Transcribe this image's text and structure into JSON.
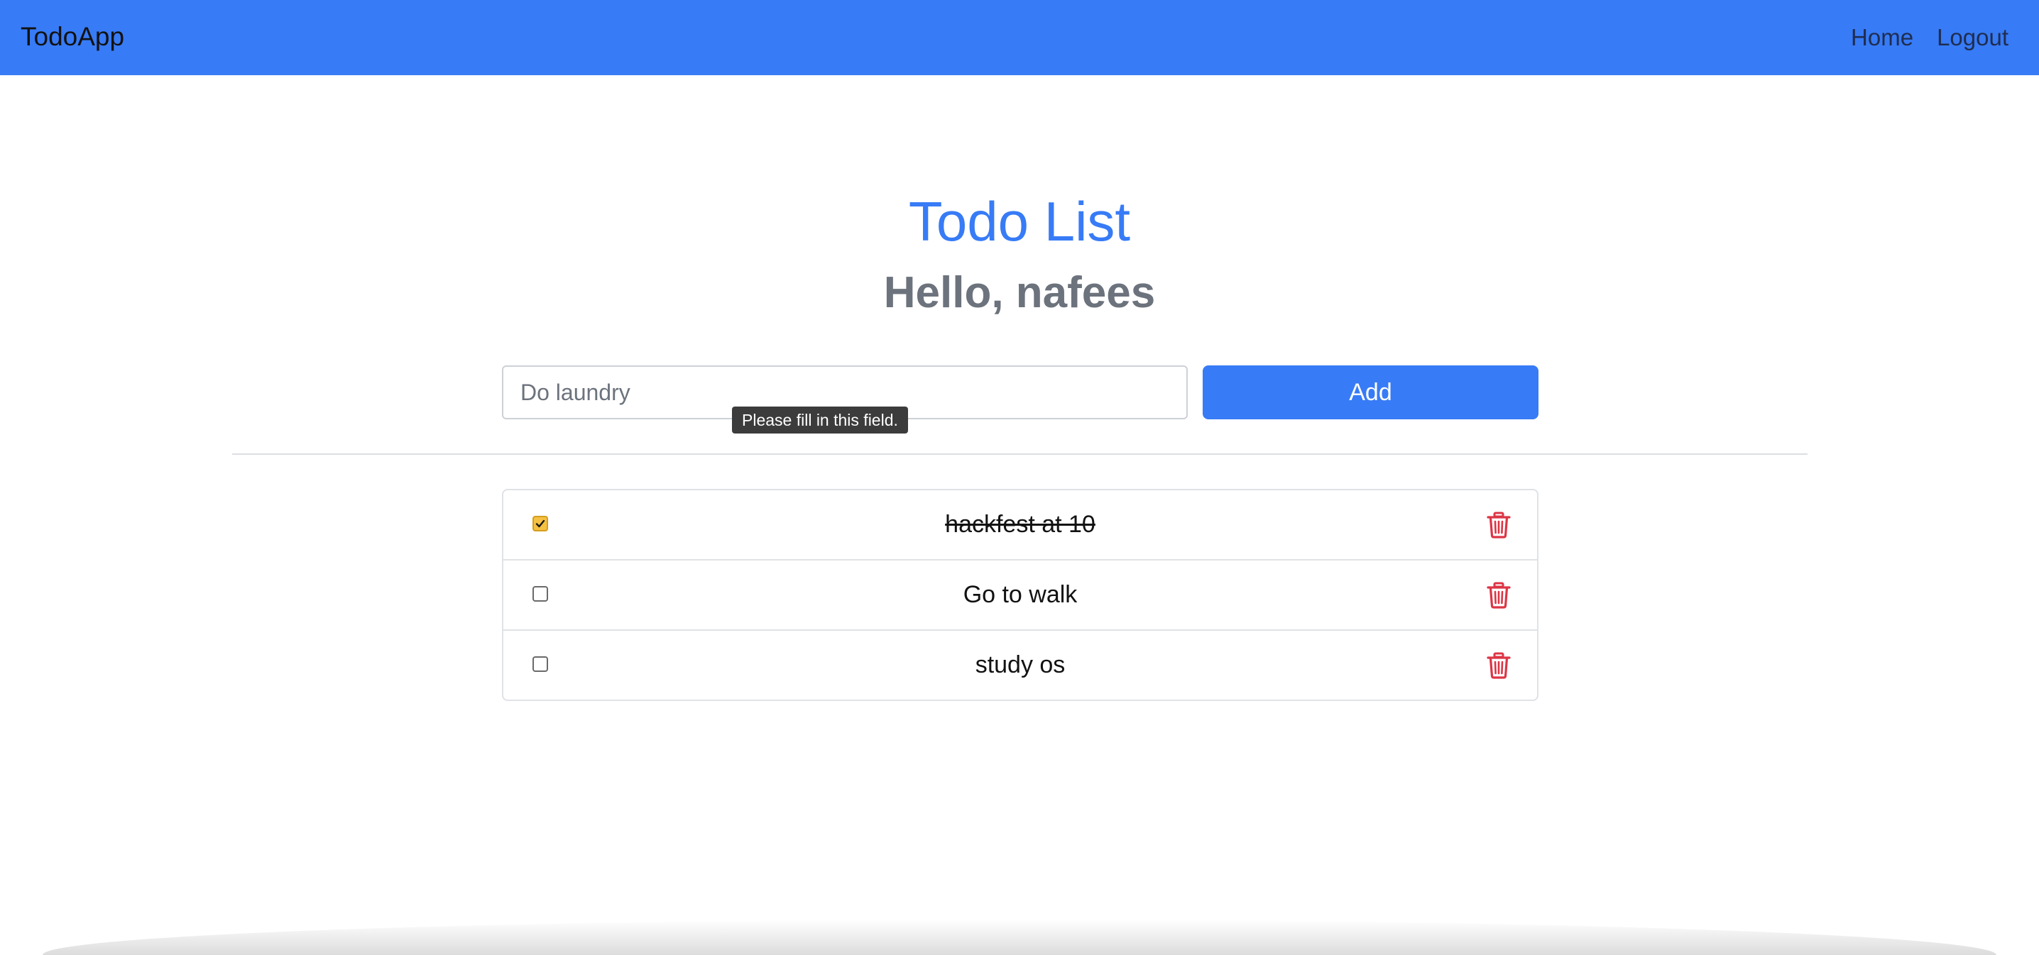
{
  "navbar": {
    "brand": "TodoApp",
    "links": [
      "Home",
      "Logout"
    ]
  },
  "main": {
    "title": "Todo List",
    "greeting": "Hello, nafees"
  },
  "form": {
    "input_placeholder": "Do laundry",
    "input_value": "",
    "add_label": "Add",
    "validation_tooltip": "Please fill in this field."
  },
  "todos": [
    {
      "text": "hackfest at 10",
      "done": true
    },
    {
      "text": "Go to walk",
      "done": false
    },
    {
      "text": "study os",
      "done": false
    }
  ],
  "colors": {
    "primary": "#377bf6",
    "checked": "#f6c043",
    "delete": "#dc3545",
    "muted": "#6c737d"
  },
  "icons": {
    "delete": "trash-icon",
    "checked": "check-icon"
  }
}
